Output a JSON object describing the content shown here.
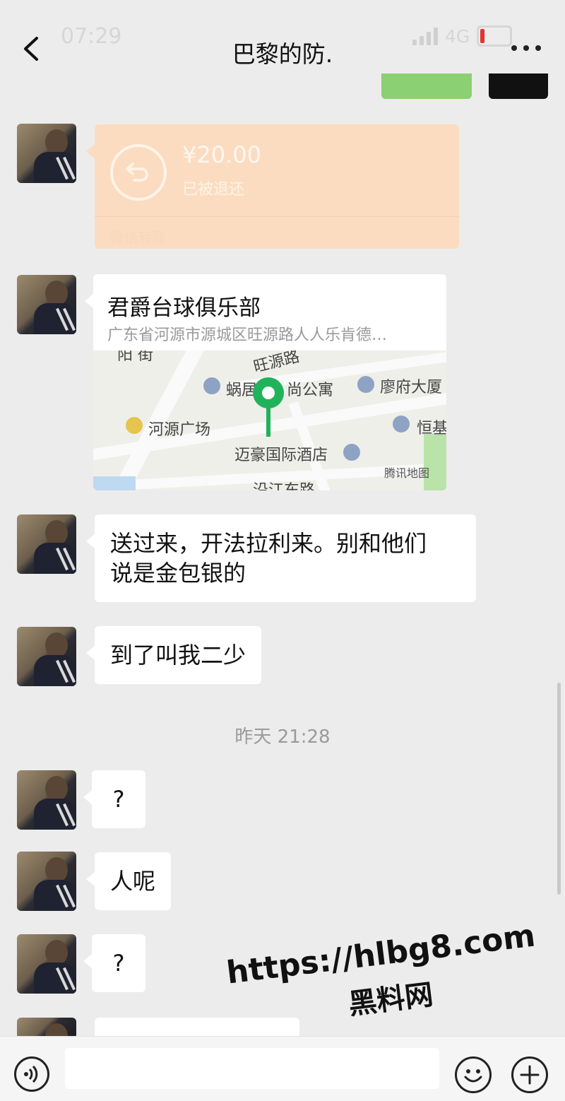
{
  "status_bar": {
    "time": "07:29",
    "network": "4G"
  },
  "header": {
    "title": "巴黎的防."
  },
  "messages": {
    "transfer": {
      "amount": "¥20.00",
      "status": "已被退还",
      "source": "微信转账"
    },
    "location": {
      "name": "君爵台球俱乐部",
      "address": "广东省河源市源城区旺源路人人乐肯德…",
      "map_labels": {
        "yang_street": "阳\n街",
        "wangyuan_road": "旺源路",
        "woju_apartment": "蜗居",
        "apartment_suffix": "尚公寓",
        "liaofu_building": "廖府大厦",
        "heyuan_square": "河源广场",
        "henglong": "恒基",
        "maihao_hotel": "迈豪国际酒店",
        "tencent_map": "腾讯地图",
        "riverside_road": "沿江东路"
      }
    },
    "text_1": "送过来，开法拉利来。别和他们\n说是金包银的",
    "text_2": "到了叫我二少",
    "timestamp": "昨天 21:28",
    "text_3": "?",
    "text_4": "人呢",
    "text_5": "?"
  },
  "watermark": {
    "url": "https://hlbg8.com",
    "name": "黑料网"
  },
  "colors": {
    "transfer_bg": "#fbdcc0",
    "sent_bubble": "#8bd072",
    "map_pin": "#21b35b"
  }
}
